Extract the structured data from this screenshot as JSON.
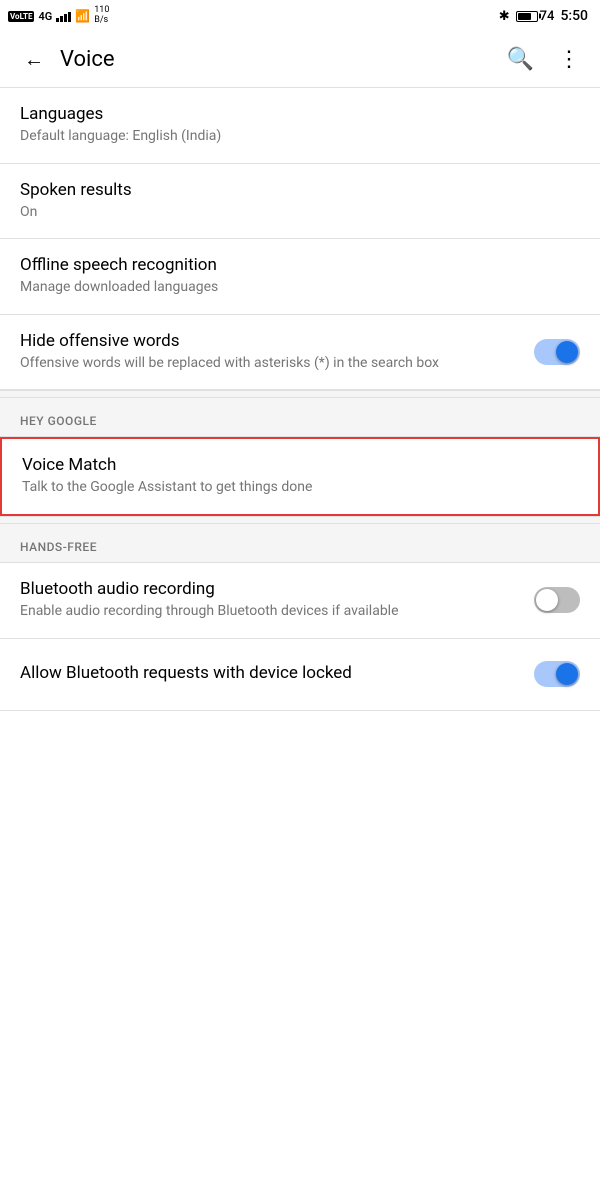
{
  "statusBar": {
    "left": {
      "volte": "VoLTE",
      "network": "4G",
      "speed": "110\nB/s"
    },
    "right": {
      "batteryPercent": "74",
      "time": "5:50"
    }
  },
  "appBar": {
    "title": "Voice",
    "backLabel": "←",
    "searchLabel": "🔍",
    "moreLabel": "⋮"
  },
  "sections": {
    "main": {
      "items": [
        {
          "title": "Languages",
          "subtitle": "Default language: English (India)",
          "toggle": null
        },
        {
          "title": "Spoken results",
          "subtitle": "On",
          "toggle": null
        },
        {
          "title": "Offline speech recognition",
          "subtitle": "Manage downloaded languages",
          "toggle": null
        },
        {
          "title": "Hide offensive words",
          "subtitle": "Offensive words will be replaced with asterisks (*) in the search box",
          "toggle": "on"
        }
      ]
    },
    "heyGoogle": {
      "header": "HEY GOOGLE",
      "items": [
        {
          "title": "Voice Match",
          "subtitle": "Talk to the Google Assistant to get things done",
          "toggle": null,
          "highlighted": true
        }
      ]
    },
    "handsFree": {
      "header": "HANDS-FREE",
      "items": [
        {
          "title": "Bluetooth audio recording",
          "subtitle": "Enable audio recording through Bluetooth devices if available",
          "toggle": "off"
        },
        {
          "title": "Allow Bluetooth requests with device locked",
          "subtitle": "",
          "toggle": "on"
        }
      ]
    }
  }
}
